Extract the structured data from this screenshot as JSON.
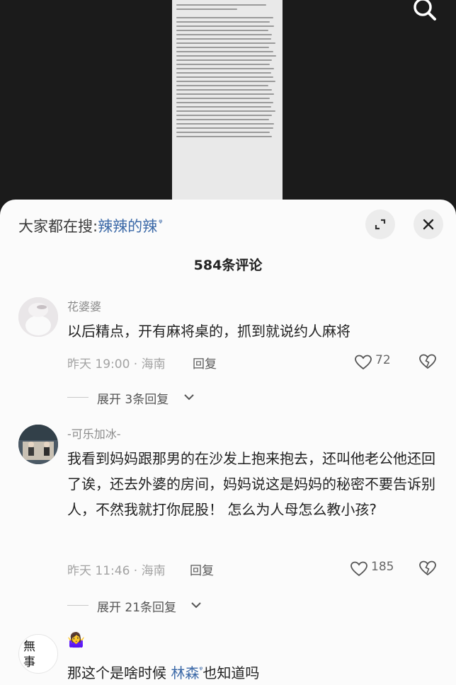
{
  "video": {
    "search_icon": "search-icon"
  },
  "sheet": {
    "search_prefix": "大家都在搜:",
    "search_keyword": "辣辣的辣",
    "search_keyword_icon": "ᵠ",
    "collapse_icon": "collapse-corner-icon",
    "close_icon": "close-icon",
    "comment_count_title": "584条评论"
  },
  "comments": [
    {
      "username": "花婆婆",
      "text": "以后精点，开有麻将桌的，抓到就说约人麻将",
      "time_location": "昨天 19:00 · 海南",
      "reply_label": "回复",
      "likes": "72",
      "expand_label": "展开 3条回复"
    },
    {
      "username": "-可乐加冰-",
      "text": "我看到妈妈跟那男的在沙发上抱来抱去，还叫他老公他还回了诶，还去外婆的房间，妈妈说这是妈妈的秘密不要告诉别人，不然我就打你屁股！ 怎么为人母怎么教小孩?",
      "time_location": "昨天 11:46 · 海南",
      "reply_label": "回复",
      "likes": "185",
      "expand_label": "展开 21条回复"
    },
    {
      "username_emoji": "🤷‍♀️",
      "text_before": "那这个是啥时候 ",
      "text_keyword": "林森",
      "text_after": "也知道吗",
      "avatar_text": "無事"
    }
  ]
}
